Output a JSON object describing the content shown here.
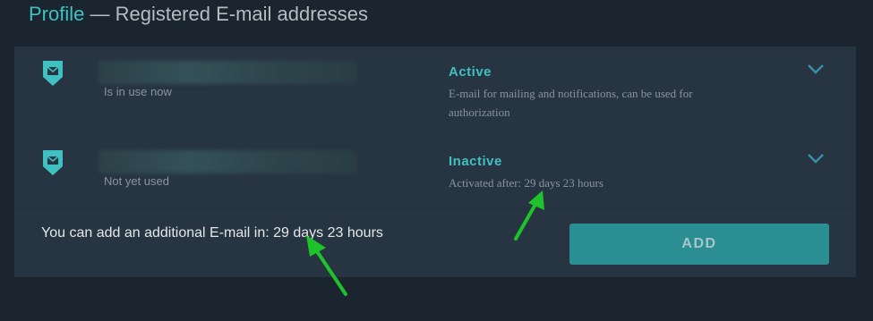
{
  "header": {
    "breadcrumb": "Profile",
    "title": " — Registered E-mail addresses"
  },
  "emails": [
    {
      "address_text": "",
      "sub_label": "Is in use now",
      "status": "Active",
      "description": "E-mail for mailing and notifications, can be used for authorization",
      "icon": "envelope-shield-icon"
    },
    {
      "address_text": "",
      "sub_label": "Not yet used",
      "status": "Inactive",
      "description": "Activated after: 29 days 23 hours",
      "icon": "envelope-shield-icon"
    }
  ],
  "footer": {
    "message": "You can add an additional E-mail in: 29 days 23 hours",
    "add_label": "ADD"
  },
  "colors": {
    "accent": "#3fc1c2",
    "button": "#2a8e93",
    "panel": "#273542",
    "background": "#1b2530",
    "annotation_arrow": "#1ec22a"
  }
}
